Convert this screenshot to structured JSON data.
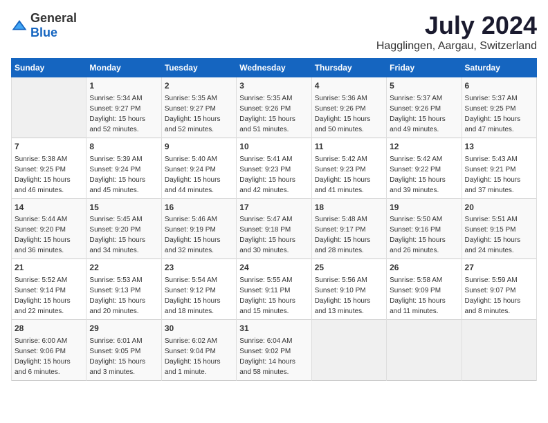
{
  "logo": {
    "general": "General",
    "blue": "Blue"
  },
  "header": {
    "month": "July 2024",
    "location": "Hagglingen, Aargau, Switzerland"
  },
  "weekdays": [
    "Sunday",
    "Monday",
    "Tuesday",
    "Wednesday",
    "Thursday",
    "Friday",
    "Saturday"
  ],
  "weeks": [
    [
      {
        "day": "",
        "info": ""
      },
      {
        "day": "1",
        "info": "Sunrise: 5:34 AM\nSunset: 9:27 PM\nDaylight: 15 hours\nand 52 minutes."
      },
      {
        "day": "2",
        "info": "Sunrise: 5:35 AM\nSunset: 9:27 PM\nDaylight: 15 hours\nand 52 minutes."
      },
      {
        "day": "3",
        "info": "Sunrise: 5:35 AM\nSunset: 9:26 PM\nDaylight: 15 hours\nand 51 minutes."
      },
      {
        "day": "4",
        "info": "Sunrise: 5:36 AM\nSunset: 9:26 PM\nDaylight: 15 hours\nand 50 minutes."
      },
      {
        "day": "5",
        "info": "Sunrise: 5:37 AM\nSunset: 9:26 PM\nDaylight: 15 hours\nand 49 minutes."
      },
      {
        "day": "6",
        "info": "Sunrise: 5:37 AM\nSunset: 9:25 PM\nDaylight: 15 hours\nand 47 minutes."
      }
    ],
    [
      {
        "day": "7",
        "info": "Sunrise: 5:38 AM\nSunset: 9:25 PM\nDaylight: 15 hours\nand 46 minutes."
      },
      {
        "day": "8",
        "info": "Sunrise: 5:39 AM\nSunset: 9:24 PM\nDaylight: 15 hours\nand 45 minutes."
      },
      {
        "day": "9",
        "info": "Sunrise: 5:40 AM\nSunset: 9:24 PM\nDaylight: 15 hours\nand 44 minutes."
      },
      {
        "day": "10",
        "info": "Sunrise: 5:41 AM\nSunset: 9:23 PM\nDaylight: 15 hours\nand 42 minutes."
      },
      {
        "day": "11",
        "info": "Sunrise: 5:42 AM\nSunset: 9:23 PM\nDaylight: 15 hours\nand 41 minutes."
      },
      {
        "day": "12",
        "info": "Sunrise: 5:42 AM\nSunset: 9:22 PM\nDaylight: 15 hours\nand 39 minutes."
      },
      {
        "day": "13",
        "info": "Sunrise: 5:43 AM\nSunset: 9:21 PM\nDaylight: 15 hours\nand 37 minutes."
      }
    ],
    [
      {
        "day": "14",
        "info": "Sunrise: 5:44 AM\nSunset: 9:20 PM\nDaylight: 15 hours\nand 36 minutes."
      },
      {
        "day": "15",
        "info": "Sunrise: 5:45 AM\nSunset: 9:20 PM\nDaylight: 15 hours\nand 34 minutes."
      },
      {
        "day": "16",
        "info": "Sunrise: 5:46 AM\nSunset: 9:19 PM\nDaylight: 15 hours\nand 32 minutes."
      },
      {
        "day": "17",
        "info": "Sunrise: 5:47 AM\nSunset: 9:18 PM\nDaylight: 15 hours\nand 30 minutes."
      },
      {
        "day": "18",
        "info": "Sunrise: 5:48 AM\nSunset: 9:17 PM\nDaylight: 15 hours\nand 28 minutes."
      },
      {
        "day": "19",
        "info": "Sunrise: 5:50 AM\nSunset: 9:16 PM\nDaylight: 15 hours\nand 26 minutes."
      },
      {
        "day": "20",
        "info": "Sunrise: 5:51 AM\nSunset: 9:15 PM\nDaylight: 15 hours\nand 24 minutes."
      }
    ],
    [
      {
        "day": "21",
        "info": "Sunrise: 5:52 AM\nSunset: 9:14 PM\nDaylight: 15 hours\nand 22 minutes."
      },
      {
        "day": "22",
        "info": "Sunrise: 5:53 AM\nSunset: 9:13 PM\nDaylight: 15 hours\nand 20 minutes."
      },
      {
        "day": "23",
        "info": "Sunrise: 5:54 AM\nSunset: 9:12 PM\nDaylight: 15 hours\nand 18 minutes."
      },
      {
        "day": "24",
        "info": "Sunrise: 5:55 AM\nSunset: 9:11 PM\nDaylight: 15 hours\nand 15 minutes."
      },
      {
        "day": "25",
        "info": "Sunrise: 5:56 AM\nSunset: 9:10 PM\nDaylight: 15 hours\nand 13 minutes."
      },
      {
        "day": "26",
        "info": "Sunrise: 5:58 AM\nSunset: 9:09 PM\nDaylight: 15 hours\nand 11 minutes."
      },
      {
        "day": "27",
        "info": "Sunrise: 5:59 AM\nSunset: 9:07 PM\nDaylight: 15 hours\nand 8 minutes."
      }
    ],
    [
      {
        "day": "28",
        "info": "Sunrise: 6:00 AM\nSunset: 9:06 PM\nDaylight: 15 hours\nand 6 minutes."
      },
      {
        "day": "29",
        "info": "Sunrise: 6:01 AM\nSunset: 9:05 PM\nDaylight: 15 hours\nand 3 minutes."
      },
      {
        "day": "30",
        "info": "Sunrise: 6:02 AM\nSunset: 9:04 PM\nDaylight: 15 hours\nand 1 minute."
      },
      {
        "day": "31",
        "info": "Sunrise: 6:04 AM\nSunset: 9:02 PM\nDaylight: 14 hours\nand 58 minutes."
      },
      {
        "day": "",
        "info": ""
      },
      {
        "day": "",
        "info": ""
      },
      {
        "day": "",
        "info": ""
      }
    ]
  ]
}
